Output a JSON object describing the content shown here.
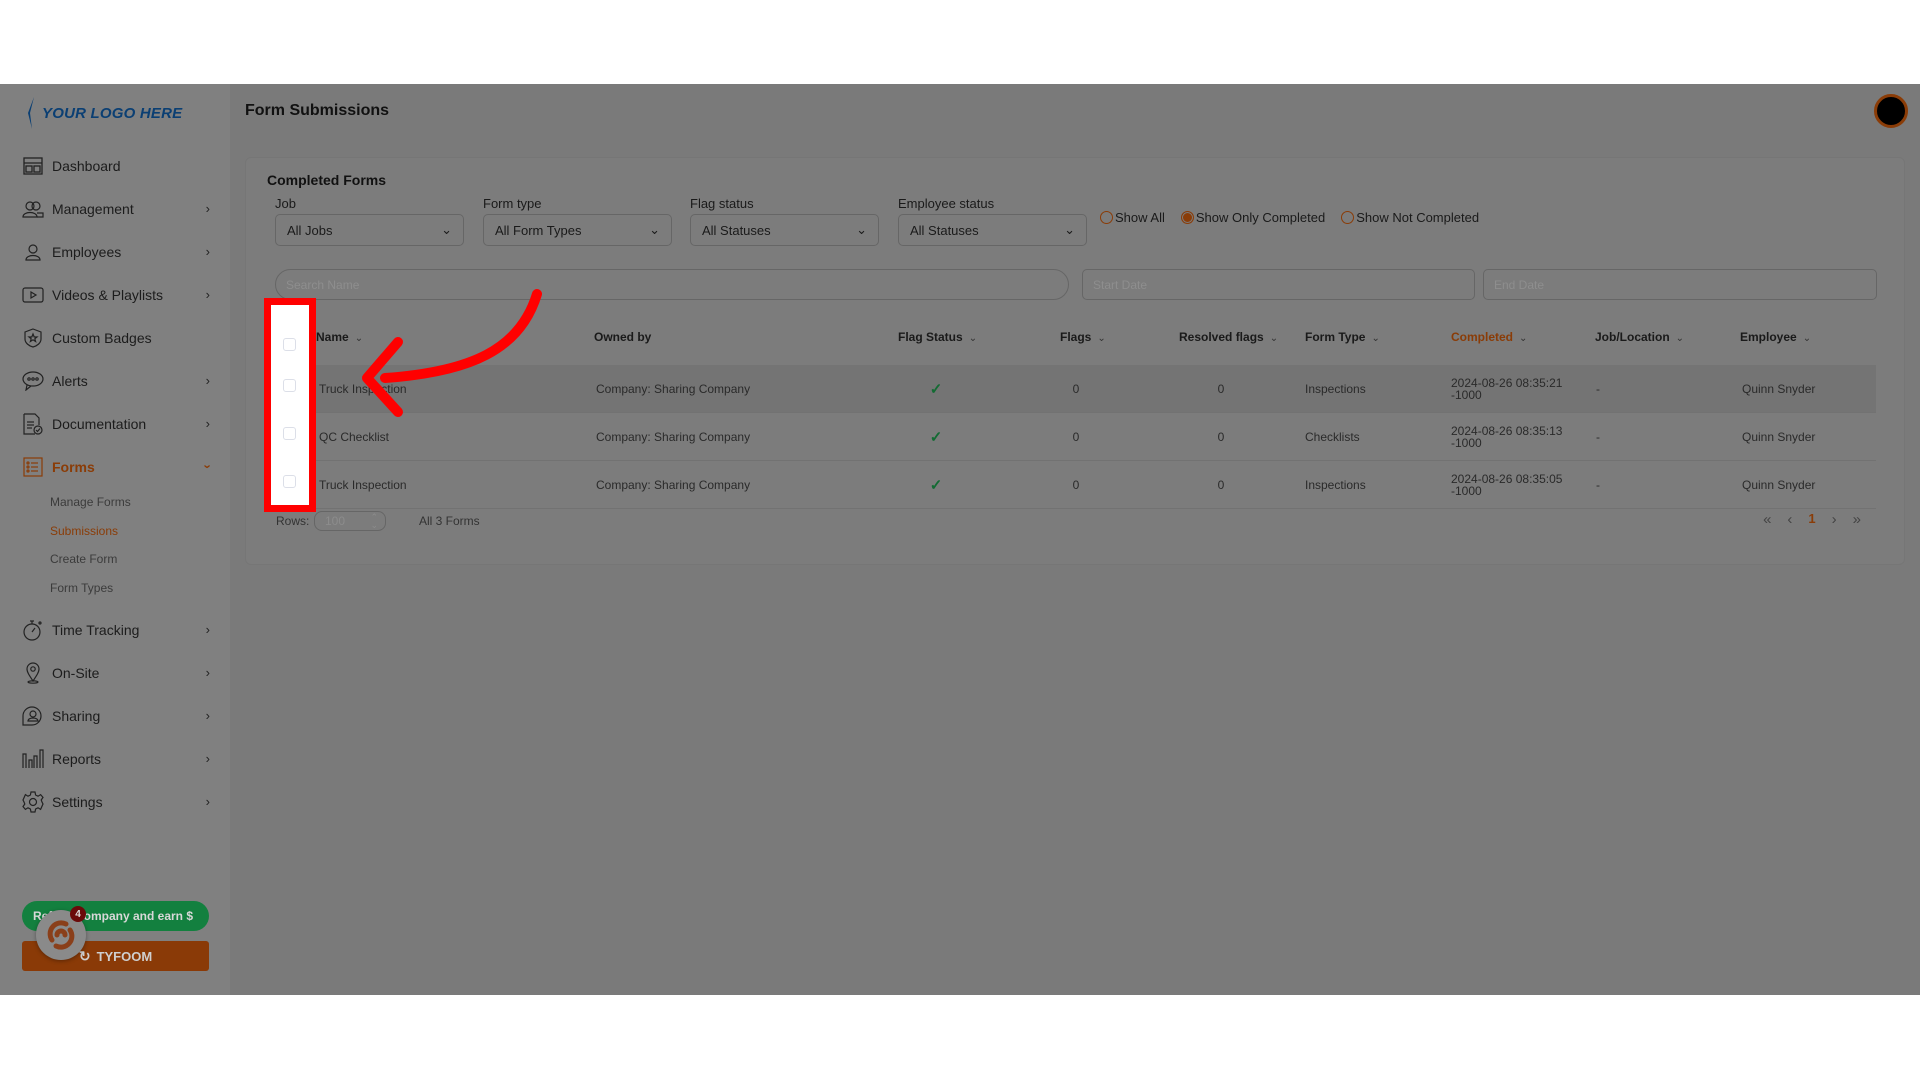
{
  "app": {
    "logo_text": "YOUR LOGO HERE",
    "page_title": "Form Submissions",
    "avatar": "user-avatar"
  },
  "sidebar": {
    "items": [
      {
        "label": "Dashboard",
        "icon": "dashboard-icon",
        "chevron": false
      },
      {
        "label": "Management",
        "icon": "management-icon",
        "chevron": true
      },
      {
        "label": "Employees",
        "icon": "employees-icon",
        "chevron": true
      },
      {
        "label": "Videos & Playlists",
        "icon": "video-icon",
        "chevron": true
      },
      {
        "label": "Custom Badges",
        "icon": "badge-icon",
        "chevron": false
      },
      {
        "label": "Alerts",
        "icon": "alerts-icon",
        "chevron": true
      },
      {
        "label": "Documentation",
        "icon": "documentation-icon",
        "chevron": true
      },
      {
        "label": "Forms",
        "icon": "forms-icon",
        "chevron": true,
        "expanded": true,
        "active": true
      },
      {
        "label": "Time Tracking",
        "icon": "stopwatch-icon",
        "chevron": true
      },
      {
        "label": "On-Site",
        "icon": "location-pin-icon",
        "chevron": true
      },
      {
        "label": "Sharing",
        "icon": "sharing-icon",
        "chevron": true
      },
      {
        "label": "Reports",
        "icon": "reports-icon",
        "chevron": true
      },
      {
        "label": "Settings",
        "icon": "gear-icon",
        "chevron": true
      }
    ],
    "forms_sub": [
      {
        "label": "Manage Forms",
        "active": false
      },
      {
        "label": "Submissions",
        "active": true
      },
      {
        "label": "Create Form",
        "active": false
      },
      {
        "label": "Form Types",
        "active": false
      }
    ],
    "promo_label": "Refer a company and earn $",
    "tyfoom_label": "TYFOOM",
    "widget_badge": "4"
  },
  "card": {
    "title": "Completed Forms",
    "filters": [
      {
        "label": "Job",
        "value": "All Jobs"
      },
      {
        "label": "Form type",
        "value": "All Form Types"
      },
      {
        "label": "Flag status",
        "value": "All Statuses"
      },
      {
        "label": "Employee status",
        "value": "All Statuses"
      }
    ],
    "radios": [
      {
        "label": "Show All",
        "selected": false
      },
      {
        "label": "Show Only Completed",
        "selected": true
      },
      {
        "label": "Show Not Completed",
        "selected": false
      }
    ],
    "search_placeholder": "Search Name",
    "start_placeholder": "Start Date",
    "end_placeholder": "End Date"
  },
  "table": {
    "columns": [
      "Name",
      "Owned by",
      "Flag Status",
      "Flags",
      "Resolved flags",
      "Form Type",
      "Completed",
      "Job/Location",
      "Employee"
    ],
    "sorted_column": "Completed",
    "rows": [
      {
        "name": "Truck Inspection",
        "owned_by": "Company: Sharing Company",
        "flag_status": "✓",
        "flags": "0",
        "resolved": "0",
        "form_type": "Inspections",
        "completed_1": "2024-08-26 08:35:21",
        "completed_2": "-1000",
        "job": "-",
        "employee": "Quinn Snyder"
      },
      {
        "name": "QC Checklist",
        "owned_by": "Company: Sharing Company",
        "flag_status": "✓",
        "flags": "0",
        "resolved": "0",
        "form_type": "Checklists",
        "completed_1": "2024-08-26 08:35:13",
        "completed_2": "-1000",
        "job": "-",
        "employee": "Quinn Snyder"
      },
      {
        "name": "Truck Inspection",
        "owned_by": "Company: Sharing Company",
        "flag_status": "✓",
        "flags": "0",
        "resolved": "0",
        "form_type": "Inspections",
        "completed_1": "2024-08-26 08:35:05",
        "completed_2": "-1000",
        "job": "-",
        "employee": "Quinn Snyder"
      }
    ],
    "rows_label": "Rows:",
    "rows_value": "100",
    "count_label": "All 3 Forms",
    "pager": {
      "first": "«",
      "prev": "‹",
      "current": "1",
      "next": "›",
      "last": "»"
    }
  },
  "colors": {
    "accent": "#8a3c07",
    "success": "#136b33",
    "highlight": "#ff0000"
  }
}
